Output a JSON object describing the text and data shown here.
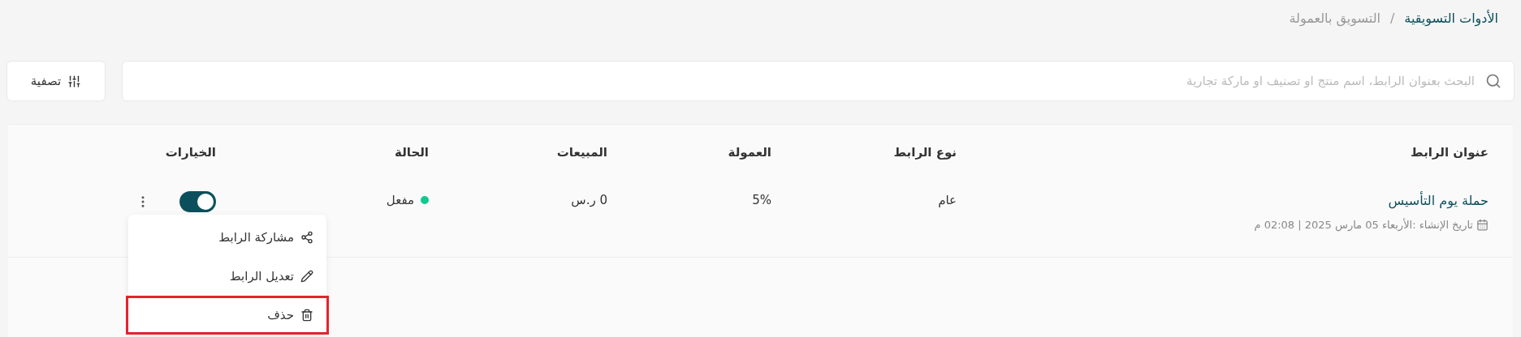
{
  "breadcrumb": [
    {
      "label": "الأدوات التسويقية",
      "current": false
    },
    {
      "label": "التسويق بالعمولة",
      "current": true
    }
  ],
  "breadcrumb_separator": "/",
  "search": {
    "placeholder": "البحث بعنوان الرابط، اسم منتج او تصنيف او ماركة تجارية"
  },
  "filter_button": {
    "label": "تصفية"
  },
  "table": {
    "columns": [
      "عنوان الرابط",
      "نوع الرابط",
      "العمولة",
      "المبيعات",
      "الحالة",
      "الخيارات"
    ],
    "rows": [
      {
        "title": "حملة يوم التأسيس",
        "created": "تاريخ الإنشاء :الأربعاء 05 مارس 2025 | 02:08 م",
        "type": "عام",
        "commission": "5%",
        "sales": "0 ر.س",
        "status": {
          "label": "مفعل",
          "color": "#10c98f"
        },
        "on": true
      }
    ]
  },
  "menu": {
    "items": [
      {
        "kind": "share",
        "label": "مشاركة الرابط",
        "highlighted": false
      },
      {
        "kind": "edit",
        "label": "تعديل الرابط",
        "highlighted": false
      },
      {
        "kind": "delete",
        "label": "حذف",
        "highlighted": true
      }
    ]
  }
}
